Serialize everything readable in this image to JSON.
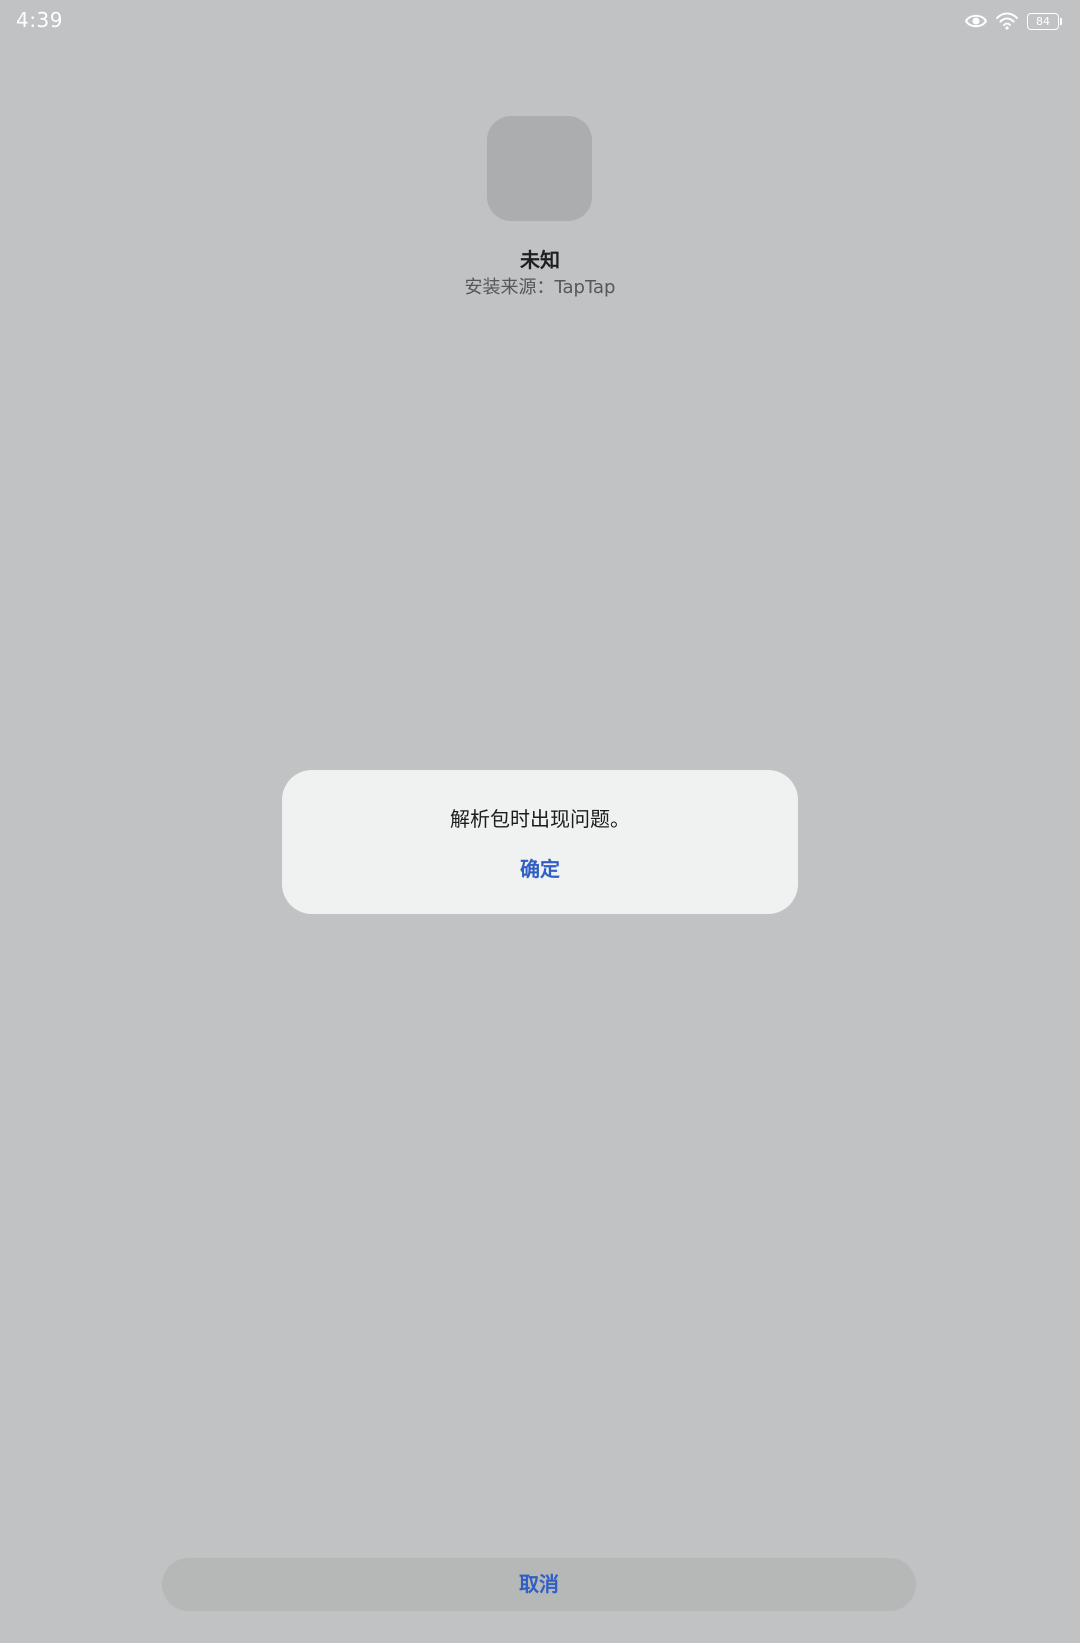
{
  "status_bar": {
    "time": "4:39",
    "battery_level": "84",
    "icons": [
      "eye-icon",
      "wifi-icon",
      "battery-icon"
    ]
  },
  "app": {
    "name": "未知",
    "source": "安装来源：TapTap"
  },
  "dialog": {
    "message": "解析包时出现问题。",
    "ok_label": "确定"
  },
  "footer": {
    "cancel_label": "取消"
  },
  "colors": {
    "background": "#c1c2c4",
    "dialog_background": "#f0f2f2",
    "accent": "#2f5fc4",
    "placeholder_icon": "#acadaf"
  }
}
